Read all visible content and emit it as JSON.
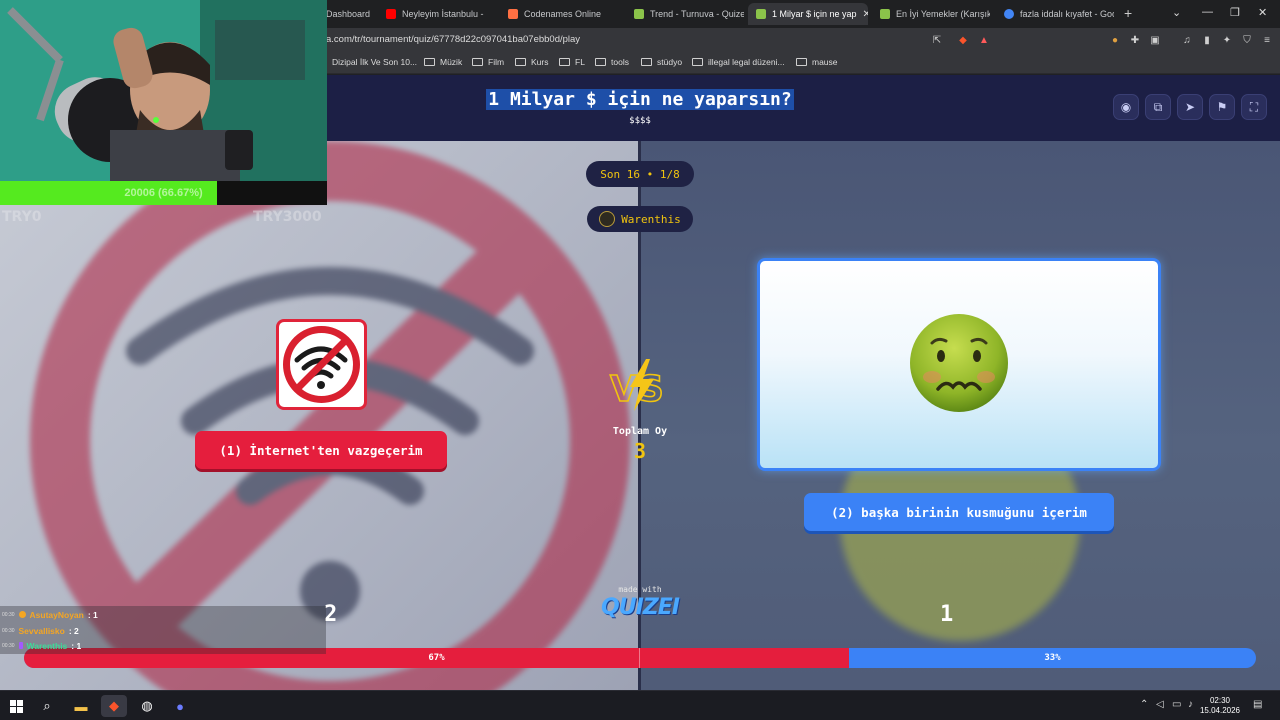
{
  "browser": {
    "tabs": [
      {
        "label": "Dashboard",
        "color": "#5c6bc0"
      },
      {
        "label": "Neyleyim İstanbulu -",
        "color": "#ff0000"
      },
      {
        "label": "Codenames Online",
        "color": "#ff7043"
      },
      {
        "label": "Trend - Turnuva - Quizei",
        "color": "#8bc34a"
      },
      {
        "label": "1 Milyar $ için ne yap",
        "color": "#8bc34a"
      },
      {
        "label": "En İyi Yemekler (Karışık)",
        "color": "#8bc34a"
      },
      {
        "label": "fazla iddalı kıyafet - Goog",
        "color": "#4285f4"
      }
    ],
    "active_tab_close": "✕",
    "new_tab": "+",
    "url": "a.com/tr/tournament/quiz/67778d22c097041ba07ebb0d/play",
    "bookmarks": [
      "Dizipal İlk Ve Son 10...",
      "Müzik",
      "Film",
      "Kurs",
      "FL",
      "tools",
      "stüdyo",
      "illegal legal düzeni...",
      "mause"
    ]
  },
  "quiz": {
    "title": "1 Milyar $ için ne yaparsın?",
    "subtitle": "$$$$",
    "round": "Son 16 • 1/8",
    "player": "Warenthis",
    "left_option": "(1) İnternet'ten vazgeçerim",
    "right_option": "(2) başka birinin kusmuğunu içerim",
    "total_label": "Toplam Oy",
    "total_value": "3",
    "left_votes": "2",
    "right_votes": "1",
    "left_percent_label": "67%",
    "right_percent_label": "33%",
    "left_fraction": 0.67,
    "made_with": "made with",
    "brand": "QUIZEI",
    "colors": {
      "left": "#e51e3d",
      "right": "#3b82f6",
      "accent": "#f1c40f"
    }
  },
  "overlay": {
    "goal_text": "20006 (66.67%)",
    "goal_fraction": 0.667,
    "goal_min": "TRY0",
    "goal_max": "TRY3000",
    "chat": [
      {
        "time": "00:30",
        "user": "AsutayNoyan",
        "count": ": 1",
        "color": "#f5a623"
      },
      {
        "time": "00:30",
        "user": "Sevvallisko",
        "count": ": 2",
        "color": "#f5a623"
      },
      {
        "time": "00:30",
        "user": "Warenthis",
        "count": ": 1",
        "color": "#3ddc97"
      }
    ]
  },
  "taskbar": {
    "time": "02:30",
    "date": "15.04.2026"
  }
}
